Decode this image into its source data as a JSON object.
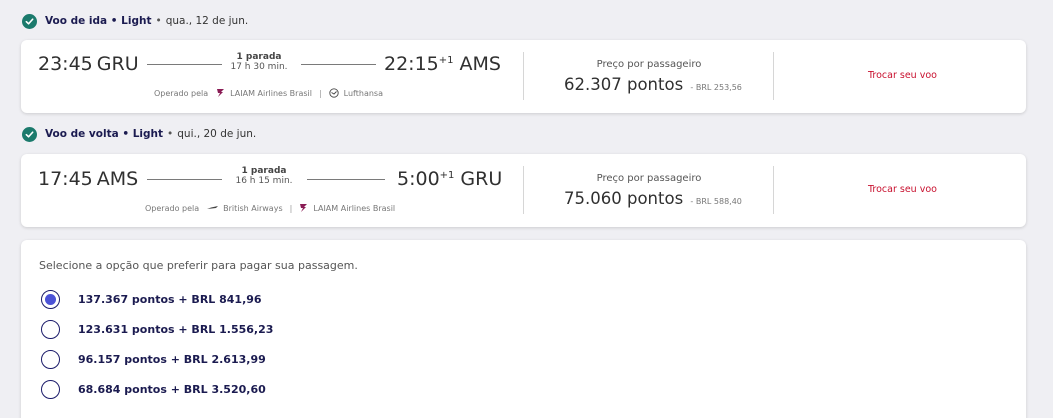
{
  "outbound": {
    "header": {
      "title": "Voo de ida",
      "fare": "Light",
      "date": "qua., 12 de jun."
    },
    "dep_time": "23:45",
    "dep_code": "GRU",
    "stops": "1 parada",
    "duration": "17 h 30 min.",
    "arr_time": "22:15",
    "arr_offset": "+1",
    "arr_code": "AMS",
    "operated_label": "Operado pela",
    "airline1": "LAIAM Airlines Brasil",
    "airline2": "Lufthansa",
    "airline1_icon": "latam-logo-icon",
    "airline2_icon": "lufthansa-logo-icon",
    "price_label": "Preço por passageiro",
    "price_points": "62.307 pontos",
    "price_brl": "- BRL 253,56",
    "change_label": "Trocar seu voo"
  },
  "inbound": {
    "header": {
      "title": "Voo de volta",
      "fare": "Light",
      "date": "qui., 20 de jun."
    },
    "dep_time": "17:45",
    "dep_code": "AMS",
    "stops": "1 parada",
    "duration": "16 h 15 min.",
    "arr_time": "5:00",
    "arr_offset": "+1",
    "arr_code": "GRU",
    "operated_label": "Operado pela",
    "airline1": "British Airways",
    "airline2": "LAIAM Airlines Brasil",
    "airline1_icon": "british-airways-logo-icon",
    "airline2_icon": "latam-logo-icon",
    "price_label": "Preço por passageiro",
    "price_points": "75.060 pontos",
    "price_brl": "- BRL 588,40",
    "change_label": "Trocar seu voo"
  },
  "payment": {
    "title": "Selecione a opção que preferir para pagar sua passagem.",
    "options": [
      {
        "label": "137.367 pontos + BRL 841,96",
        "selected": true
      },
      {
        "label": "123.631 pontos + BRL 1.556,23",
        "selected": false
      },
      {
        "label": "96.157 pontos + BRL 2.613,99",
        "selected": false
      },
      {
        "label": "68.684 pontos + BRL 3.520,60",
        "selected": false
      }
    ]
  },
  "colors": {
    "check": "#1b7a6c",
    "change_link": "#c8102e",
    "radio_selected": "#4b52d6",
    "navy_text": "#1b1b50"
  }
}
